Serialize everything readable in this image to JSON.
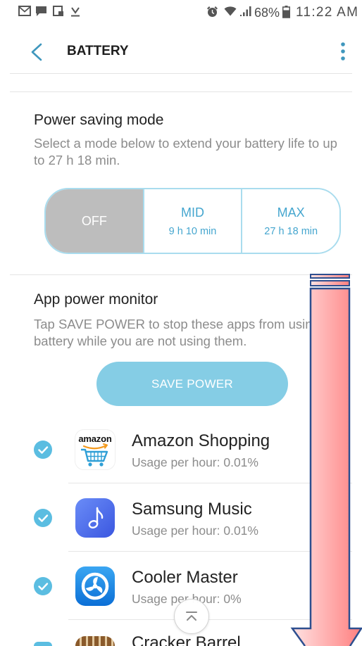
{
  "status_bar": {
    "battery": "68%",
    "time": "11:22 AM"
  },
  "app_bar": {
    "title": "BATTERY"
  },
  "power_saving": {
    "heading": "Power saving mode",
    "description": "Select a mode below to extend your battery life to up to 27 h 18 min.",
    "modes": [
      {
        "label": "OFF",
        "selected": true
      },
      {
        "label": "MID",
        "detail": "9 h 10 min",
        "selected": false
      },
      {
        "label": "MAX",
        "detail": "27 h 18 min",
        "selected": false
      }
    ]
  },
  "app_power_monitor": {
    "heading": "App power monitor",
    "description": "Tap SAVE POWER to stop these apps from using battery while you are not using them.",
    "save_button_label": "SAVE POWER",
    "apps": [
      {
        "name": "Amazon Shopping",
        "usage": "Usage per hour: 0.01%",
        "checked": true,
        "icon": "amazon-shopping-icon",
        "logo_text": "amazon"
      },
      {
        "name": "Samsung Music",
        "usage": "Usage per hour: 0.01%",
        "checked": true,
        "icon": "samsung-music-icon"
      },
      {
        "name": "Cooler Master",
        "usage": "Usage per hour: 0%",
        "checked": true,
        "icon": "cooler-master-icon"
      },
      {
        "name": "Cracker Barrel",
        "checked": true,
        "icon": "cracker-barrel-icon"
      }
    ]
  },
  "icons": {
    "status_left": [
      "email-icon",
      "message-icon",
      "screenshot-icon",
      "download-complete-icon"
    ],
    "status_right": [
      "alarm-icon",
      "wifi-icon",
      "signal-icon",
      "battery-icon"
    ],
    "back": "back-chevron-icon",
    "menu": "more-options-icon",
    "check": "check-icon",
    "scroll_top": "scroll-to-top-icon",
    "annotation": "down-arrow-annotation"
  },
  "colors": {
    "accent": "#3f97bd",
    "text_primary": "#222222",
    "text_secondary": "#8c8c8c",
    "segment_border": "#a9dcee",
    "segment_selected_bg": "#bdbdbd",
    "save_button_bg": "#85cde5",
    "check_bg": "#5bbde1",
    "annotation_fill": "#ff8a8a",
    "annotation_stroke": "#2d4f8f"
  }
}
